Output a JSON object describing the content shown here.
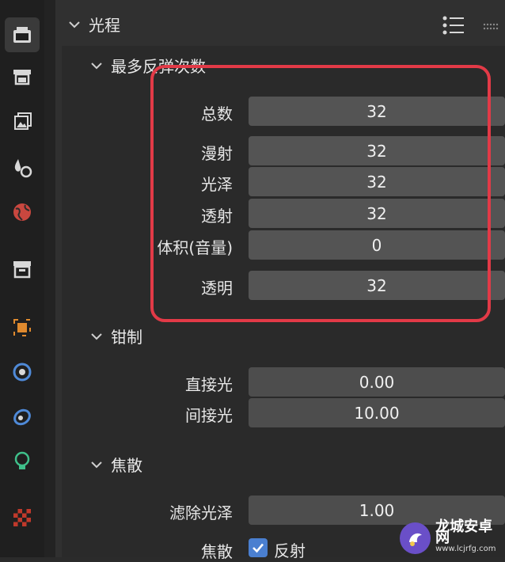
{
  "toolbar": {
    "icons": [
      {
        "name": "render-properties-icon",
        "active": true
      },
      {
        "name": "output-properties-icon"
      },
      {
        "name": "view-layer-icon"
      },
      {
        "name": "scene-icon"
      },
      {
        "name": "world-icon"
      },
      {
        "name": "collection-icon"
      },
      {
        "name": "object-icon"
      },
      {
        "name": "modifier-icon"
      },
      {
        "name": "physics-icon"
      },
      {
        "name": "object-data-light-icon"
      },
      {
        "name": "texture-icon"
      }
    ]
  },
  "light_paths": {
    "title": "光程",
    "max_bounces": {
      "title": "最多反弹次数",
      "rows": [
        {
          "label": "总数",
          "value": "32"
        },
        {
          "label": "漫射",
          "value": "32"
        },
        {
          "label": "光泽",
          "value": "32"
        },
        {
          "label": "透射",
          "value": "32"
        },
        {
          "label": "体积(音量)",
          "value": "0"
        },
        {
          "label": "透明",
          "value": "32"
        }
      ]
    },
    "clamping": {
      "title": "钳制",
      "rows": [
        {
          "label": "直接光",
          "value": "0.00"
        },
        {
          "label": "间接光",
          "value": "10.00"
        }
      ]
    },
    "caustics": {
      "title": "焦散",
      "filter_glossy_label": "滤除光泽",
      "filter_glossy_value": "1.00",
      "caustics_label": "焦散",
      "reflective_label": "反射",
      "reflective_checked": true
    }
  },
  "watermark": {
    "title": "龙城安卓网",
    "url": "www.lcjrfg.com"
  },
  "colors": {
    "highlight": "#e23a47",
    "checkbox": "#4a7fd0"
  }
}
